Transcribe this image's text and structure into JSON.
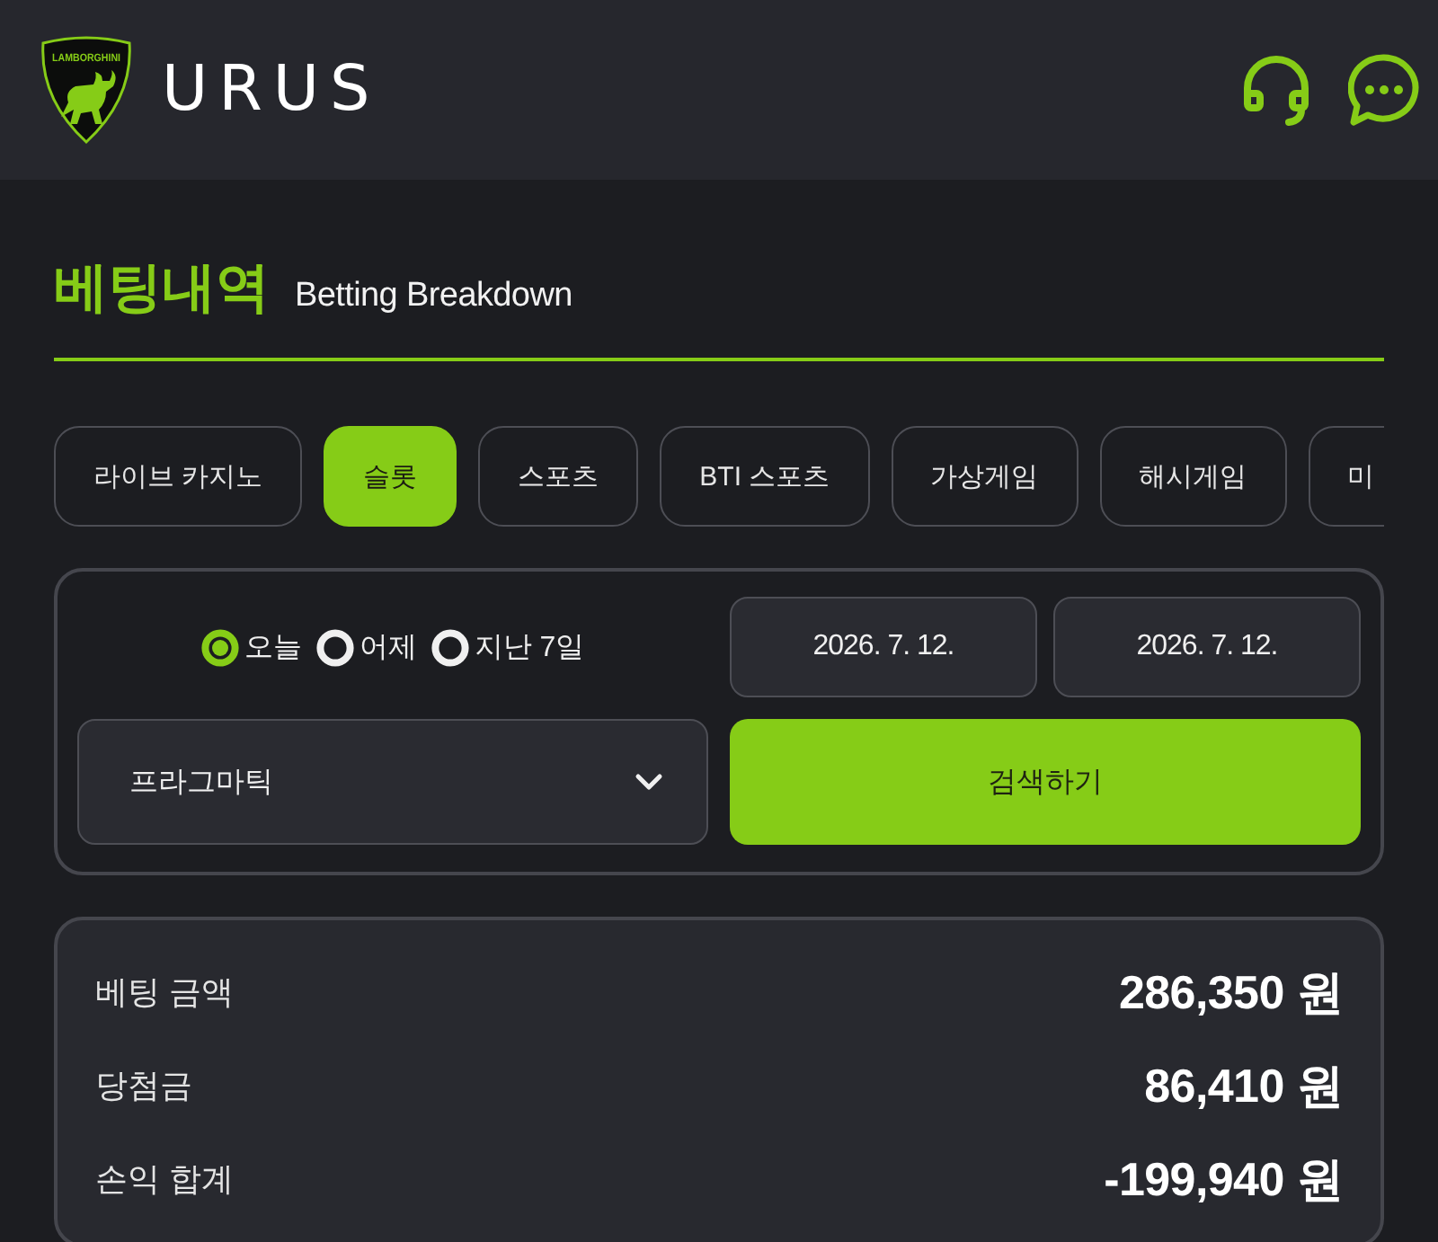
{
  "header": {
    "logo_text": "LAMBORGHINI",
    "brand": "URUS"
  },
  "title": {
    "korean": "베팅내역",
    "english": "Betting Breakdown"
  },
  "tabs": [
    {
      "label": "라이브 카지노",
      "selected": false
    },
    {
      "label": "슬롯",
      "selected": true
    },
    {
      "label": "스포츠",
      "selected": false
    },
    {
      "label": "BTI 스포츠",
      "selected": false
    },
    {
      "label": "가상게임",
      "selected": false
    },
    {
      "label": "해시게임",
      "selected": false
    },
    {
      "label": "미",
      "selected": false
    }
  ],
  "filter": {
    "periods": [
      {
        "label": "오늘",
        "selected": true
      },
      {
        "label": "어제",
        "selected": false
      },
      {
        "label": "지난 7일",
        "selected": false
      }
    ],
    "date_from": "2026. 7. 12.",
    "date_to": "2026. 7. 12.",
    "provider": "프라그마틱",
    "search_button": "검색하기"
  },
  "summary": [
    {
      "label": "베팅 금액",
      "value": "286,350 원"
    },
    {
      "label": "당첨금",
      "value": "86,410 원"
    },
    {
      "label": "손익 합계",
      "value": "-199,940 원"
    }
  ]
}
